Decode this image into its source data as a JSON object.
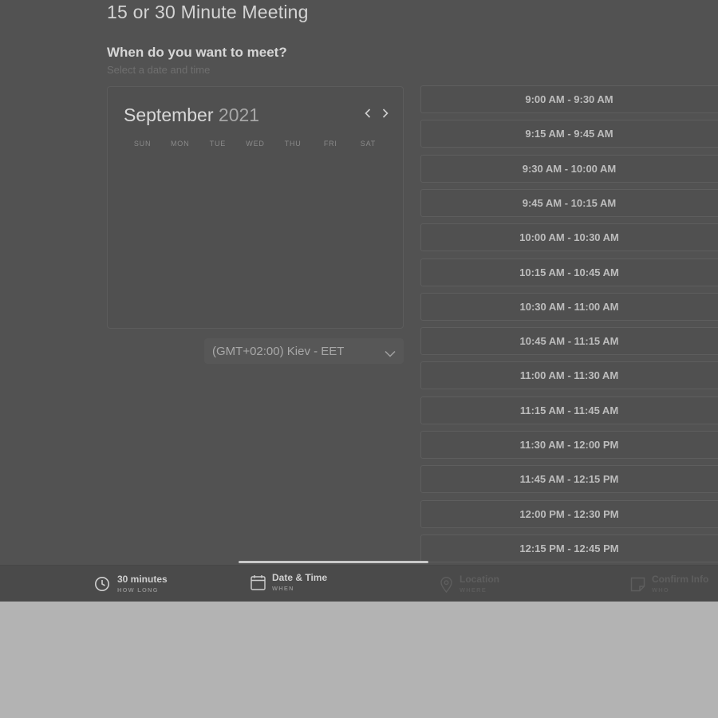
{
  "header": {
    "title": "15 or 30 Minute Meeting",
    "section_title": "When do you want to meet?",
    "section_subtitle": "Select a date and time"
  },
  "calendar": {
    "month": "September",
    "year": "2021",
    "prev_icon": "chevron-left-icon",
    "next_icon": "chevron-right-icon",
    "weekdays": [
      "SUN",
      "MON",
      "TUE",
      "WED",
      "THU",
      "FRI",
      "SAT"
    ]
  },
  "timezone": {
    "selected": "(GMT+02:00) Kiev - EET",
    "icon": "chevron-down-icon"
  },
  "time_slots": [
    "9:00 AM - 9:30 AM",
    "9:15 AM - 9:45 AM",
    "9:30 AM - 10:00 AM",
    "9:45 AM - 10:15 AM",
    "10:00 AM - 10:30 AM",
    "10:15 AM - 10:45 AM",
    "10:30 AM - 11:00 AM",
    "10:45 AM - 11:15 AM",
    "11:00 AM - 11:30 AM",
    "11:15 AM - 11:45 AM",
    "11:30 AM - 12:00 PM",
    "11:45 AM - 12:15 PM",
    "12:00 PM - 12:30 PM",
    "12:15 PM - 12:45 PM"
  ],
  "steps": [
    {
      "label": "30 minutes",
      "sublabel": "HOW LONG",
      "icon": "clock-icon",
      "state": "done"
    },
    {
      "label": "Date & Time",
      "sublabel": "WHEN",
      "icon": "calendar-icon",
      "state": "active"
    },
    {
      "label": "Location",
      "sublabel": "WHERE",
      "icon": "location-pin-icon",
      "state": "pending"
    },
    {
      "label": "Confirm Info",
      "sublabel": "WHO",
      "icon": "note-icon",
      "state": "pending"
    }
  ],
  "colors": {
    "overlay": "#525252",
    "page_background": "#b3b3b3",
    "active_text": "#d0d0d0",
    "pending_text": "#5e5e5e"
  }
}
